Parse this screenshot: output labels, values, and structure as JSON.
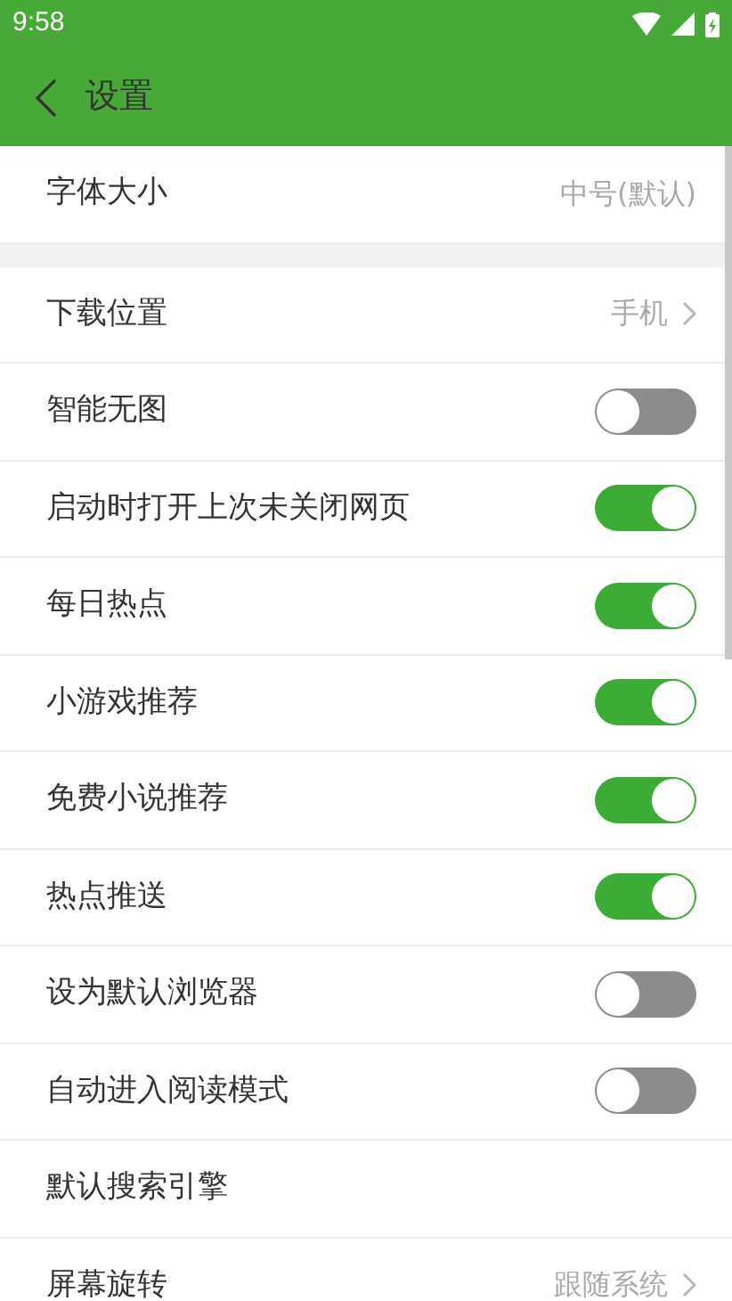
{
  "status_bar": {
    "time": "9:58"
  },
  "header": {
    "title": "设置"
  },
  "top_rows": [
    {
      "kind": "value",
      "label": "字体大小",
      "value": "中号(默认)"
    }
  ],
  "rows": [
    {
      "kind": "link",
      "label": "下载位置",
      "value": "手机"
    },
    {
      "kind": "toggle",
      "label": "智能无图",
      "on": false
    },
    {
      "kind": "toggle",
      "label": "启动时打开上次未关闭网页",
      "on": true
    },
    {
      "kind": "toggle",
      "label": "每日热点",
      "on": true
    },
    {
      "kind": "toggle",
      "label": "小游戏推荐",
      "on": true
    },
    {
      "kind": "toggle",
      "label": "免费小说推荐",
      "on": true
    },
    {
      "kind": "toggle",
      "label": "热点推送",
      "on": true
    },
    {
      "kind": "toggle",
      "label": "设为默认浏览器",
      "on": false
    },
    {
      "kind": "toggle",
      "label": "自动进入阅读模式",
      "on": false
    },
    {
      "kind": "label",
      "label": "默认搜索引擎"
    },
    {
      "kind": "link",
      "label": "屏幕旋转",
      "value": "跟随系统"
    }
  ]
}
